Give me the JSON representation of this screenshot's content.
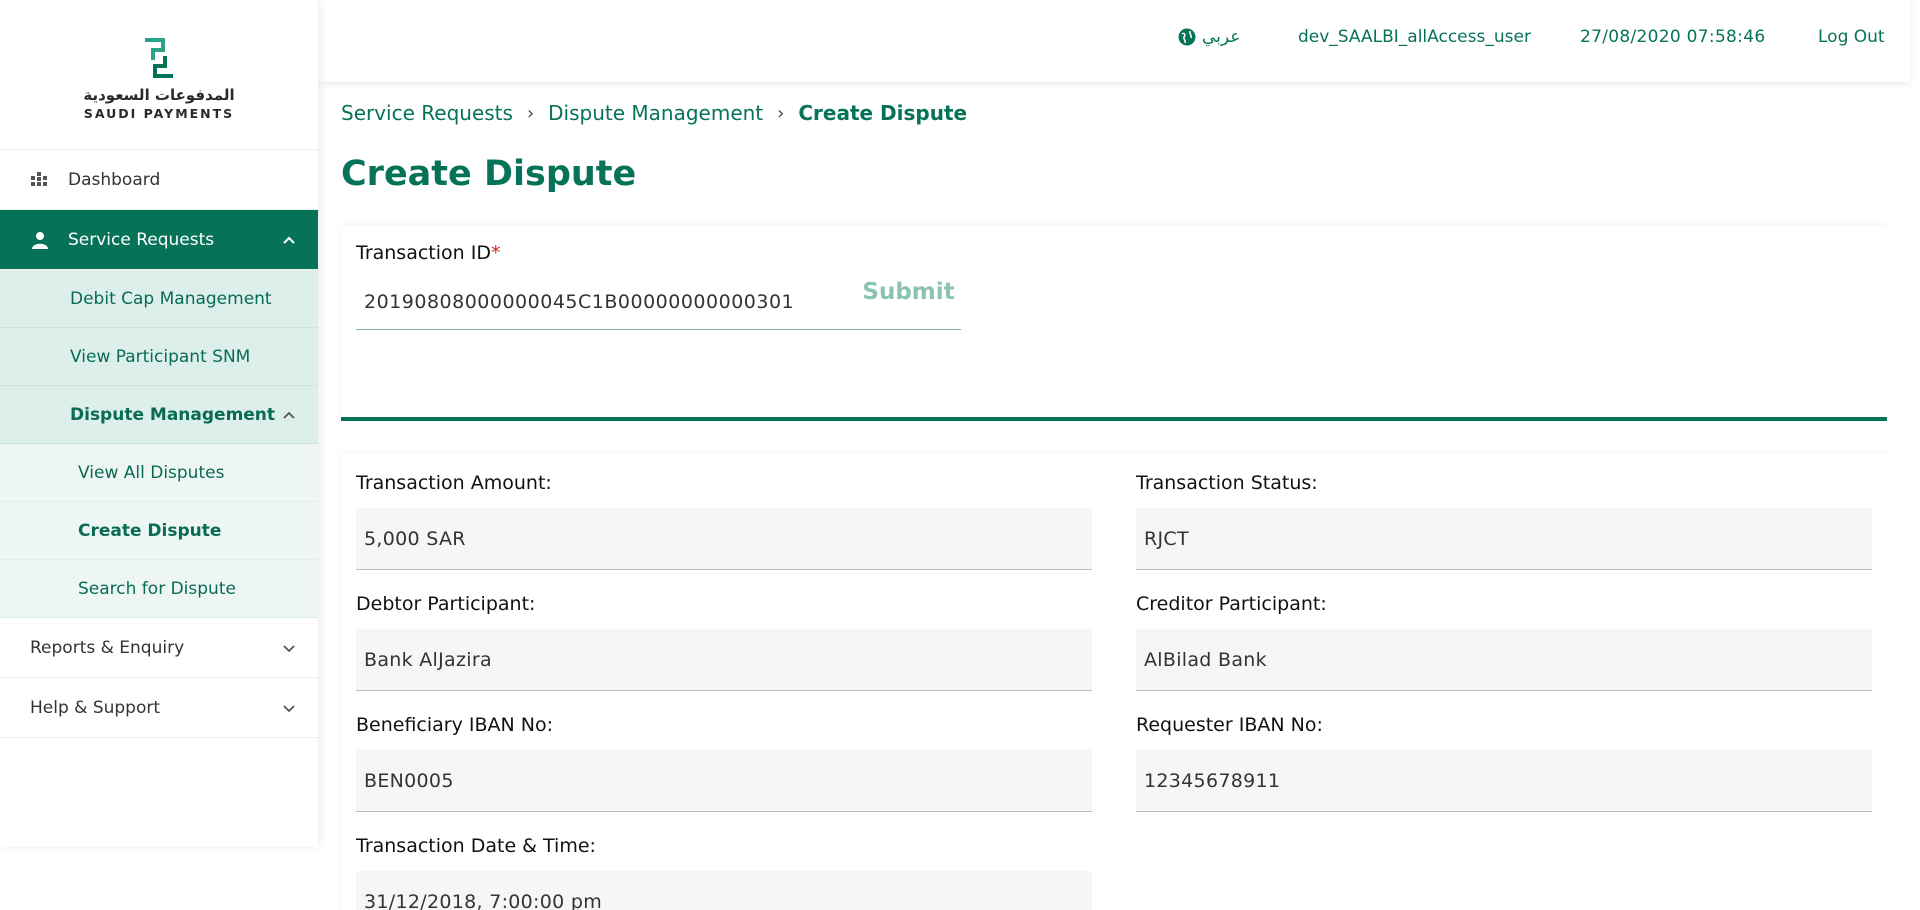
{
  "logo": {
    "arabic": "المدفوعات السعودية",
    "english": "SAUDI PAYMENTS"
  },
  "sidebar": {
    "items": [
      {
        "label": "Dashboard",
        "icon": "dashboard-grid-icon"
      },
      {
        "label": "Service Requests",
        "icon": "user-icon"
      },
      {
        "label": "Reports & Enquiry"
      },
      {
        "label": "Help & Support"
      }
    ],
    "service_sub": [
      "Debit Cap Management",
      "View Participant SNM",
      "Dispute Management"
    ],
    "dispute_sub": [
      "View All Disputes",
      "Create Dispute",
      "Search for Dispute"
    ]
  },
  "header": {
    "language": "عربي",
    "language_icon": "globe-icon",
    "username": "dev_SAALBI_allAccess_user",
    "datetime": "27/08/2020  07:58:46",
    "logout": "Log Out"
  },
  "breadcrumb": [
    "Service Requests",
    "Dispute Management",
    "Create Dispute"
  ],
  "page_title": "Create Dispute",
  "form": {
    "transaction_id_label": "Transaction ID",
    "transaction_id_value": "20190808000000045C1B00000000000301",
    "submit_label": "Submit"
  },
  "details": {
    "amount_label": "Transaction Amount:",
    "amount_value": "5,000 SAR",
    "status_label": "Transaction Status:",
    "status_value": "RJCT",
    "debtor_label": "Debtor Participant:",
    "debtor_value": "Bank AlJazira",
    "creditor_label": "Creditor Participant:",
    "creditor_value": "AlBilad Bank",
    "beneficiary_label": "Beneficiary IBAN No:",
    "beneficiary_value": "BEN0005",
    "requester_label": "Requester IBAN No:",
    "requester_value": "12345678911",
    "datetime_label": "Transaction Date & Time:",
    "datetime_value": "31/12/2018, 7:00:00 pm"
  },
  "colors": {
    "brand": "#067359",
    "submit_disabled": "#8cc2b4",
    "sub_bg": "#dcefea",
    "sub2_bg": "#edf6f3",
    "required": "#c62828"
  }
}
